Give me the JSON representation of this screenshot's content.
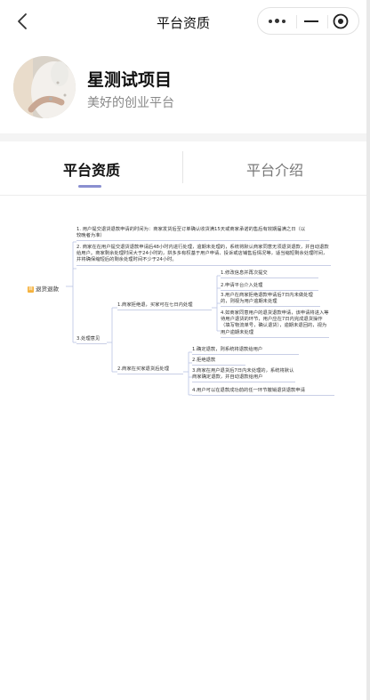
{
  "nav": {
    "title": "平台资质",
    "back_icon": "chevron-left-icon",
    "capsule": {
      "more_icon": "more-dots-icon",
      "minimize_icon": "minimize-icon",
      "close_icon": "target-close-icon"
    }
  },
  "profile": {
    "name": "星测试项目",
    "slogan": "美好的创业平台"
  },
  "tabs": [
    {
      "label": "平台资质",
      "active": true
    },
    {
      "label": "平台介绍",
      "active": false
    }
  ],
  "mindmap": {
    "root": "退货退款",
    "items": {
      "i1": "1. 用户提交退货退款申请的时间为：商家发货后至订单确认收货满15天或商家承诺的售后有效期届满之日（以较晚者为准）",
      "i2": "2. 商家在在用户提交退货退款申请后48小时内进行处理，逾期未处理的，系统将默认商家同意无须退货退款，并自动退款给用户。商家剩余处理时间大于24小时的，拼多多有权基于用户申请、投诉或店铺售后情况等，适当缩短剩余处理时间，并将确保缩短后的剩余处理时间不少于24小时。",
      "i3": "3.处理意见",
      "a": "1.商家拒绝退，买家可在七日内处理",
      "a1": "1.修改信息并再次提交",
      "a2": "2.申请平台介入处理",
      "a3": "3.用户在商家拒绝退款申请后7日内未做处理的，则视为用户逾期未处理",
      "a4": "4.如商家同意用户的退货退款申请，该申请将进入等待用户退货的环节，用户应在7日内完成退货操作（填写物流单号，确认退货），逾期未退回的，视为用户逾期未处理",
      "b": "2.商家在买家退货后处理",
      "b1": "1.确定退款，则系统将退款给用户",
      "b2": "2.拒绝退款",
      "b3": "3.商家在用户退货后7日内未处理的，系统将默认商家确定退款，并自动退款给用户",
      "b4": "4.用户可以在退款成功前的任一环节撤销退货退款申请"
    }
  }
}
